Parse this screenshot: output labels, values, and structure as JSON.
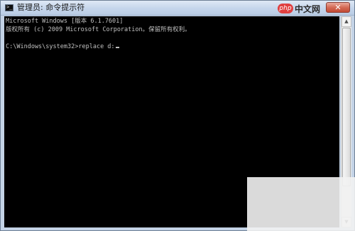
{
  "window": {
    "title": "管理员: 命令提示符",
    "close_label": "✕"
  },
  "watermark": {
    "logo": "php",
    "text": "中文网"
  },
  "console": {
    "line1": "Microsoft Windows [版本 6.1.7601]",
    "line2": "版权所有 (c) 2009 Microsoft Corporation。保留所有权利。",
    "prompt": "C:\\Windows\\system32>",
    "command": "replace d:"
  },
  "icons": {
    "app": "cmd-icon",
    "close": "close-icon",
    "scroll_up": "up-arrow-icon",
    "scroll_down": "down-arrow-icon"
  },
  "colors": {
    "console_bg": "#000000",
    "console_fg": "#c0c0c0",
    "close_button": "#c24a34",
    "frame": "#c4d3e6"
  }
}
